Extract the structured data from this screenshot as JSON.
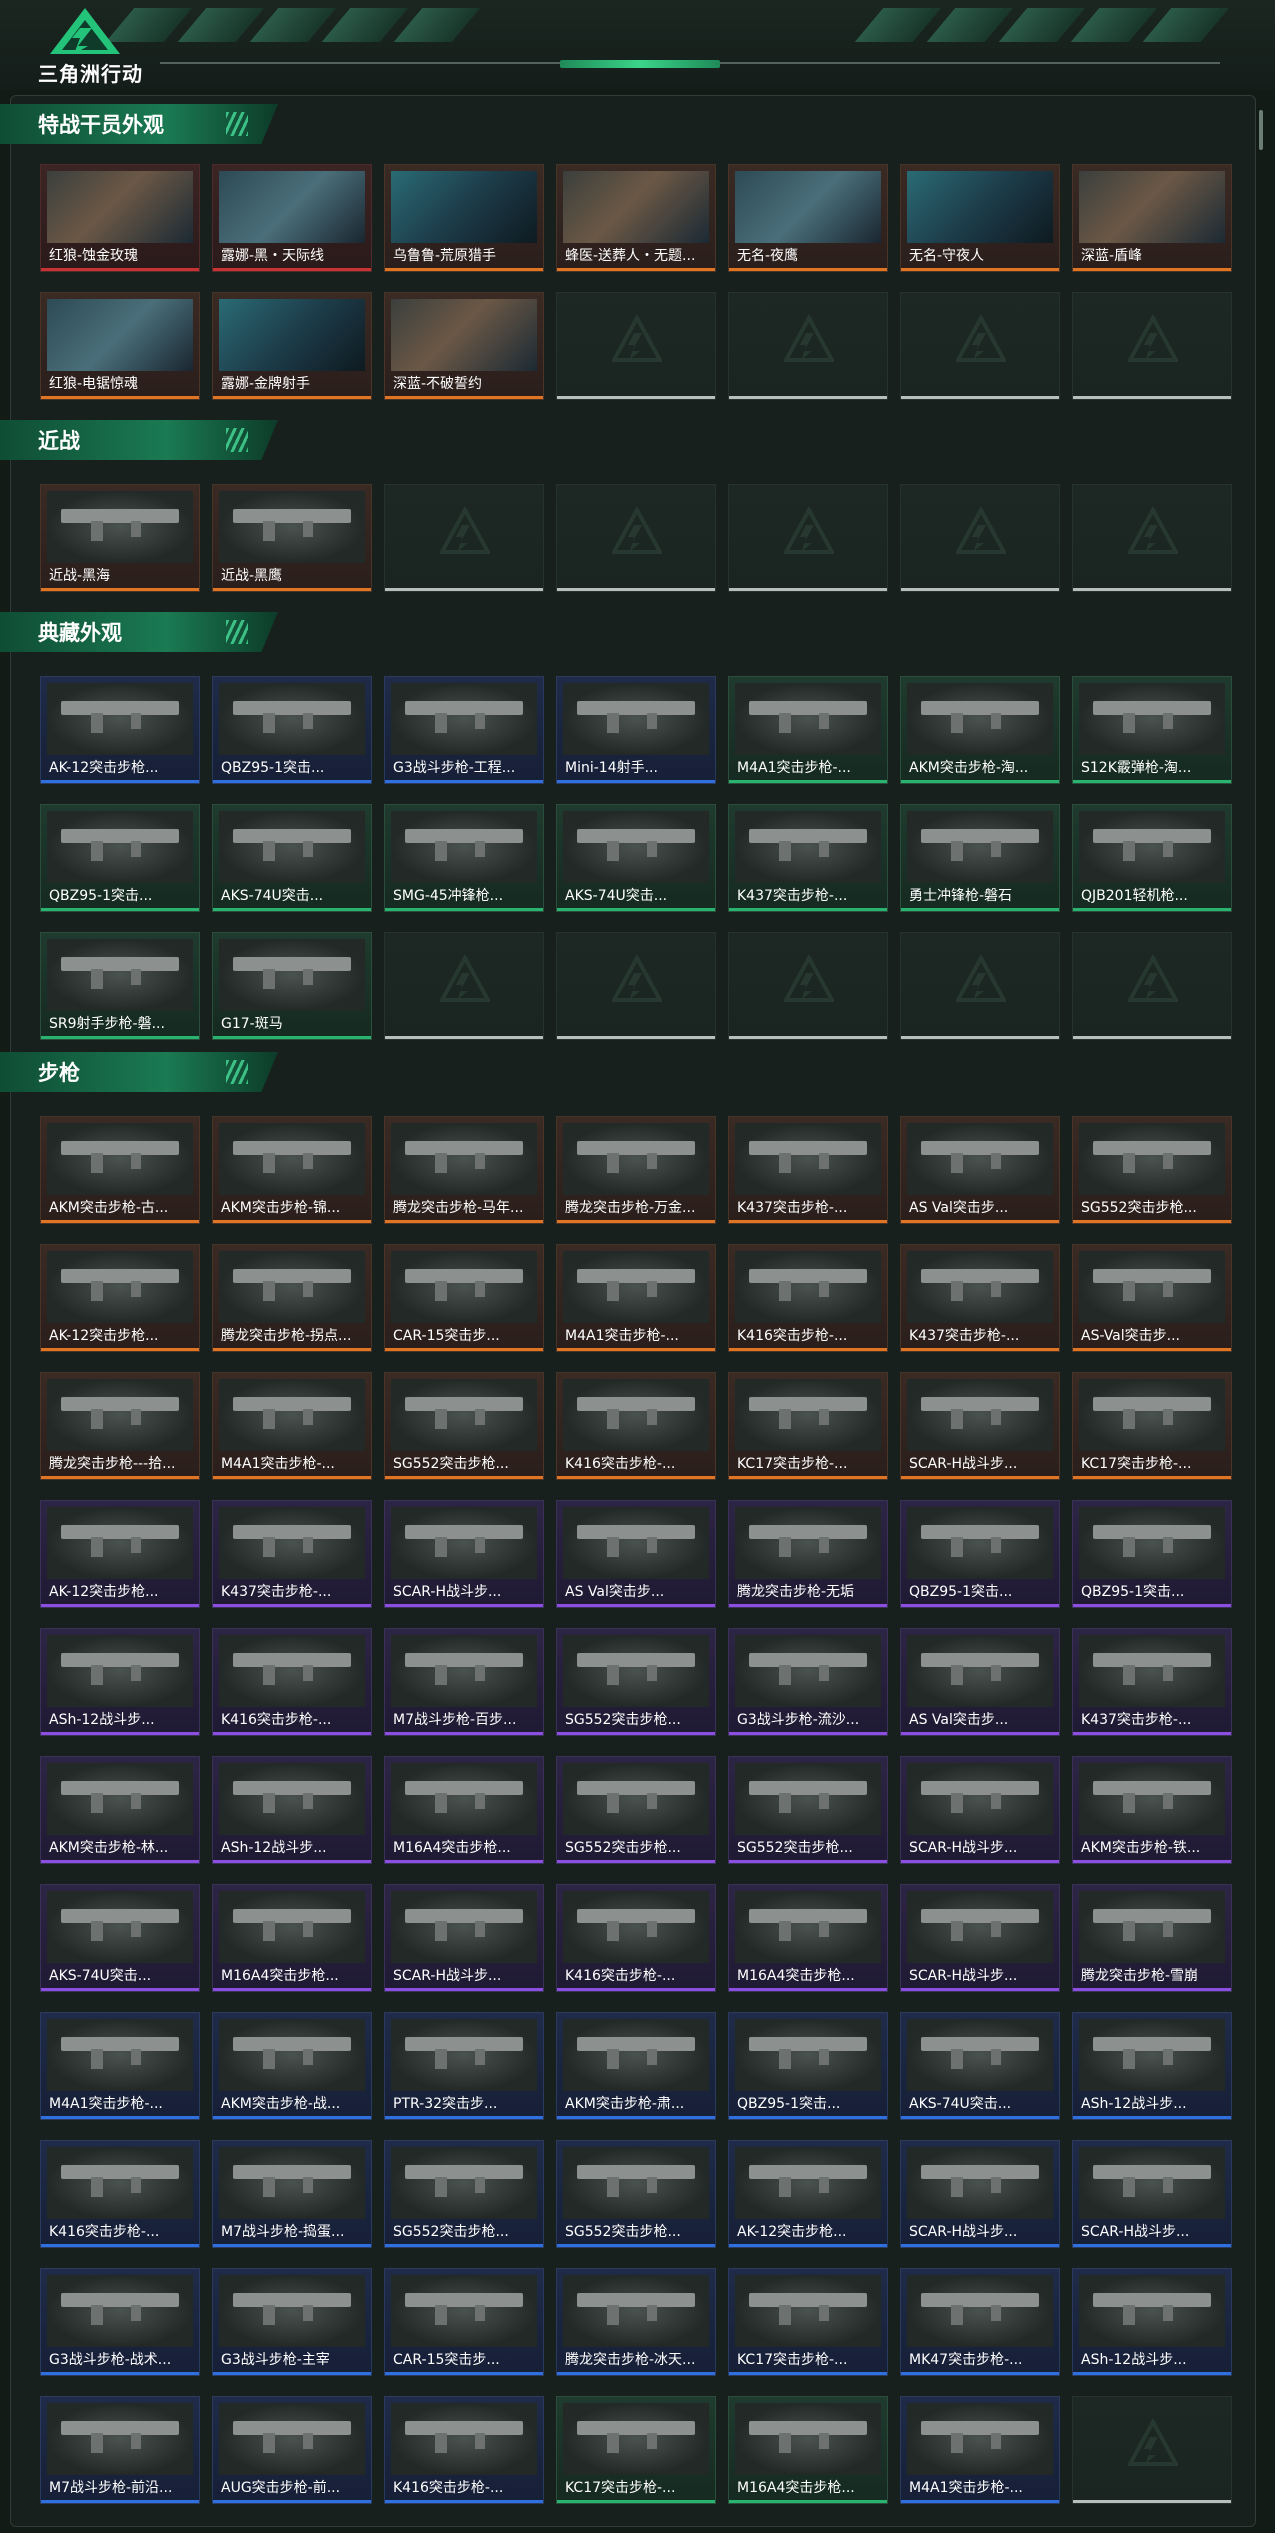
{
  "header": {
    "brand": "三角洲行动"
  },
  "colors": {
    "accent_green": "#28b46e",
    "rarity_orange": "#e07524",
    "rarity_red": "#c83232",
    "rarity_purple": "#8a4fe0",
    "rarity_blue": "#2f6fe0",
    "rarity_white": "#c9cfcc"
  },
  "sections": [
    {
      "title": "特战干员外观",
      "items": [
        {
          "label": "红狼-蚀金玫瑰",
          "rarity": "red",
          "kind": "agent"
        },
        {
          "label": "露娜-黑・天际线",
          "rarity": "red",
          "kind": "agent"
        },
        {
          "label": "乌鲁鲁-荒原猎手",
          "rarity": "orange",
          "kind": "agent"
        },
        {
          "label": "蜂医-送葬人・无题...",
          "rarity": "orange",
          "kind": "agent"
        },
        {
          "label": "无名-夜鹰",
          "rarity": "orange",
          "kind": "agent"
        },
        {
          "label": "无名-守夜人",
          "rarity": "orange",
          "kind": "agent"
        },
        {
          "label": "深蓝-盾峰",
          "rarity": "orange",
          "kind": "agent"
        },
        {
          "label": "红狼-电锯惊魂",
          "rarity": "orange",
          "kind": "agent"
        },
        {
          "label": "露娜-金牌射手",
          "rarity": "orange",
          "kind": "agent"
        },
        {
          "label": "深蓝-不破誓约",
          "rarity": "orange",
          "kind": "agent"
        },
        {
          "empty": true
        },
        {
          "empty": true
        },
        {
          "empty": true
        },
        {
          "empty": true
        }
      ]
    },
    {
      "title": "近战",
      "items": [
        {
          "label": "近战-黑海",
          "rarity": "orange",
          "kind": "weapon"
        },
        {
          "label": "近战-黑鹰",
          "rarity": "orange",
          "kind": "weapon"
        },
        {
          "empty": true
        },
        {
          "empty": true
        },
        {
          "empty": true
        },
        {
          "empty": true
        },
        {
          "empty": true
        }
      ]
    },
    {
      "title": "典藏外观",
      "items": [
        {
          "label": "AK-12突击步枪...",
          "rarity": "blue",
          "kind": "weapon"
        },
        {
          "label": "QBZ95-1突击...",
          "rarity": "blue",
          "kind": "weapon"
        },
        {
          "label": "G3战斗步枪-工程...",
          "rarity": "blue",
          "kind": "weapon"
        },
        {
          "label": "Mini-14射手...",
          "rarity": "blue",
          "kind": "weapon"
        },
        {
          "label": "M4A1突击步枪-...",
          "rarity": "green",
          "kind": "weapon"
        },
        {
          "label": "AKM突击步枪-淘...",
          "rarity": "green",
          "kind": "weapon"
        },
        {
          "label": "S12K霰弹枪-淘...",
          "rarity": "green",
          "kind": "weapon"
        },
        {
          "label": "QBZ95-1突击...",
          "rarity": "green",
          "kind": "weapon"
        },
        {
          "label": "AKS-74U突击...",
          "rarity": "green",
          "kind": "weapon"
        },
        {
          "label": "SMG-45冲锋枪...",
          "rarity": "green",
          "kind": "weapon"
        },
        {
          "label": "AKS-74U突击...",
          "rarity": "green",
          "kind": "weapon"
        },
        {
          "label": "K437突击步枪-...",
          "rarity": "green",
          "kind": "weapon"
        },
        {
          "label": "勇士冲锋枪-磐石",
          "rarity": "green",
          "kind": "weapon"
        },
        {
          "label": "QJB201轻机枪...",
          "rarity": "green",
          "kind": "weapon"
        },
        {
          "label": "SR9射手步枪-磐...",
          "rarity": "green",
          "kind": "weapon"
        },
        {
          "label": "G17-斑马",
          "rarity": "green",
          "kind": "weapon"
        },
        {
          "empty": true
        },
        {
          "empty": true
        },
        {
          "empty": true
        },
        {
          "empty": true
        },
        {
          "empty": true
        }
      ]
    },
    {
      "title": "步枪",
      "items": [
        {
          "label": "AKM突击步枪-古...",
          "rarity": "orange",
          "kind": "weapon"
        },
        {
          "label": "AKM突击步枪-锦...",
          "rarity": "orange",
          "kind": "weapon"
        },
        {
          "label": "腾龙突击步枪-马年...",
          "rarity": "orange",
          "kind": "weapon"
        },
        {
          "label": "腾龙突击步枪-万金...",
          "rarity": "orange",
          "kind": "weapon"
        },
        {
          "label": "K437突击步枪-...",
          "rarity": "orange",
          "kind": "weapon"
        },
        {
          "label": "AS Val突击步...",
          "rarity": "orange",
          "kind": "weapon"
        },
        {
          "label": "SG552突击步枪...",
          "rarity": "orange",
          "kind": "weapon"
        },
        {
          "label": "AK-12突击步枪...",
          "rarity": "orange",
          "kind": "weapon"
        },
        {
          "label": "腾龙突击步枪-拐点...",
          "rarity": "orange",
          "kind": "weapon"
        },
        {
          "label": "CAR-15突击步...",
          "rarity": "orange",
          "kind": "weapon"
        },
        {
          "label": "M4A1突击步枪-...",
          "rarity": "orange",
          "kind": "weapon"
        },
        {
          "label": "K416突击步枪-...",
          "rarity": "orange",
          "kind": "weapon"
        },
        {
          "label": "K437突击步枪-...",
          "rarity": "orange",
          "kind": "weapon"
        },
        {
          "label": "AS-Val突击步...",
          "rarity": "orange",
          "kind": "weapon"
        },
        {
          "label": "腾龙突击步枪---拾...",
          "rarity": "orange",
          "kind": "weapon"
        },
        {
          "label": "M4A1突击步枪-...",
          "rarity": "orange",
          "kind": "weapon"
        },
        {
          "label": "SG552突击步枪...",
          "rarity": "orange",
          "kind": "weapon"
        },
        {
          "label": "K416突击步枪-...",
          "rarity": "orange",
          "kind": "weapon"
        },
        {
          "label": "KC17突击步枪-...",
          "rarity": "orange",
          "kind": "weapon"
        },
        {
          "label": "SCAR-H战斗步...",
          "rarity": "orange",
          "kind": "weapon"
        },
        {
          "label": "KC17突击步枪-...",
          "rarity": "orange",
          "kind": "weapon"
        },
        {
          "label": "AK-12突击步枪...",
          "rarity": "purple",
          "kind": "weapon"
        },
        {
          "label": "K437突击步枪-...",
          "rarity": "purple",
          "kind": "weapon"
        },
        {
          "label": "SCAR-H战斗步...",
          "rarity": "purple",
          "kind": "weapon"
        },
        {
          "label": "AS Val突击步...",
          "rarity": "purple",
          "kind": "weapon"
        },
        {
          "label": "腾龙突击步枪-无垢",
          "rarity": "purple",
          "kind": "weapon"
        },
        {
          "label": "QBZ95-1突击...",
          "rarity": "purple",
          "kind": "weapon"
        },
        {
          "label": "QBZ95-1突击...",
          "rarity": "purple",
          "kind": "weapon"
        },
        {
          "label": "ASh-12战斗步...",
          "rarity": "purple",
          "kind": "weapon"
        },
        {
          "label": "K416突击步枪-...",
          "rarity": "purple",
          "kind": "weapon"
        },
        {
          "label": "M7战斗步枪-百步...",
          "rarity": "purple",
          "kind": "weapon"
        },
        {
          "label": "SG552突击步枪...",
          "rarity": "purple",
          "kind": "weapon"
        },
        {
          "label": "G3战斗步枪-流沙...",
          "rarity": "purple",
          "kind": "weapon"
        },
        {
          "label": "AS Val突击步...",
          "rarity": "purple",
          "kind": "weapon"
        },
        {
          "label": "K437突击步枪-...",
          "rarity": "purple",
          "kind": "weapon"
        },
        {
          "label": "AKM突击步枪-林...",
          "rarity": "purple",
          "kind": "weapon"
        },
        {
          "label": "ASh-12战斗步...",
          "rarity": "purple",
          "kind": "weapon"
        },
        {
          "label": "M16A4突击步枪...",
          "rarity": "purple",
          "kind": "weapon"
        },
        {
          "label": "SG552突击步枪...",
          "rarity": "purple",
          "kind": "weapon"
        },
        {
          "label": "SG552突击步枪...",
          "rarity": "purple",
          "kind": "weapon"
        },
        {
          "label": "SCAR-H战斗步...",
          "rarity": "purple",
          "kind": "weapon"
        },
        {
          "label": "AKM突击步枪-铁...",
          "rarity": "purple",
          "kind": "weapon"
        },
        {
          "label": "AKS-74U突击...",
          "rarity": "purple",
          "kind": "weapon"
        },
        {
          "label": "M16A4突击步枪...",
          "rarity": "purple",
          "kind": "weapon"
        },
        {
          "label": "SCAR-H战斗步...",
          "rarity": "purple",
          "kind": "weapon"
        },
        {
          "label": "K416突击步枪-...",
          "rarity": "purple",
          "kind": "weapon"
        },
        {
          "label": "M16A4突击步枪...",
          "rarity": "purple",
          "kind": "weapon"
        },
        {
          "label": "SCAR-H战斗步...",
          "rarity": "purple",
          "kind": "weapon"
        },
        {
          "label": "腾龙突击步枪-雪崩",
          "rarity": "purple",
          "kind": "weapon"
        },
        {
          "label": "M4A1突击步枪-...",
          "rarity": "blue",
          "kind": "weapon"
        },
        {
          "label": "AKM突击步枪-战...",
          "rarity": "blue",
          "kind": "weapon"
        },
        {
          "label": "PTR-32突击步...",
          "rarity": "blue",
          "kind": "weapon"
        },
        {
          "label": "AKM突击步枪-肃...",
          "rarity": "blue",
          "kind": "weapon"
        },
        {
          "label": "QBZ95-1突击...",
          "rarity": "blue",
          "kind": "weapon"
        },
        {
          "label": "AKS-74U突击...",
          "rarity": "blue",
          "kind": "weapon"
        },
        {
          "label": "ASh-12战斗步...",
          "rarity": "blue",
          "kind": "weapon"
        },
        {
          "label": "K416突击步枪-...",
          "rarity": "blue",
          "kind": "weapon"
        },
        {
          "label": "M7战斗步枪-捣蛋...",
          "rarity": "blue",
          "kind": "weapon"
        },
        {
          "label": "SG552突击步枪...",
          "rarity": "blue",
          "kind": "weapon"
        },
        {
          "label": "SG552突击步枪...",
          "rarity": "blue",
          "kind": "weapon"
        },
        {
          "label": "AK-12突击步枪...",
          "rarity": "blue",
          "kind": "weapon"
        },
        {
          "label": "SCAR-H战斗步...",
          "rarity": "blue",
          "kind": "weapon"
        },
        {
          "label": "SCAR-H战斗步...",
          "rarity": "blue",
          "kind": "weapon"
        },
        {
          "label": "G3战斗步枪-战术...",
          "rarity": "blue",
          "kind": "weapon"
        },
        {
          "label": "G3战斗步枪-主宰",
          "rarity": "blue",
          "kind": "weapon"
        },
        {
          "label": "CAR-15突击步...",
          "rarity": "blue",
          "kind": "weapon"
        },
        {
          "label": "腾龙突击步枪-冰天...",
          "rarity": "blue",
          "kind": "weapon"
        },
        {
          "label": "KC17突击步枪-...",
          "rarity": "blue",
          "kind": "weapon"
        },
        {
          "label": "MK47突击步枪-...",
          "rarity": "blue",
          "kind": "weapon"
        },
        {
          "label": "ASh-12战斗步...",
          "rarity": "blue",
          "kind": "weapon"
        },
        {
          "label": "M7战斗步枪-前沿...",
          "rarity": "blue",
          "kind": "weapon"
        },
        {
          "label": "AUG突击步枪-前...",
          "rarity": "blue",
          "kind": "weapon"
        },
        {
          "label": "K416突击步枪-...",
          "rarity": "blue",
          "kind": "weapon"
        },
        {
          "label": "KC17突击步枪-...",
          "rarity": "green",
          "kind": "weapon"
        },
        {
          "label": "M16A4突击步枪...",
          "rarity": "green",
          "kind": "weapon"
        },
        {
          "label": "M4A1突击步枪-...",
          "rarity": "blue",
          "kind": "weapon"
        },
        {
          "empty": true
        }
      ]
    }
  ]
}
